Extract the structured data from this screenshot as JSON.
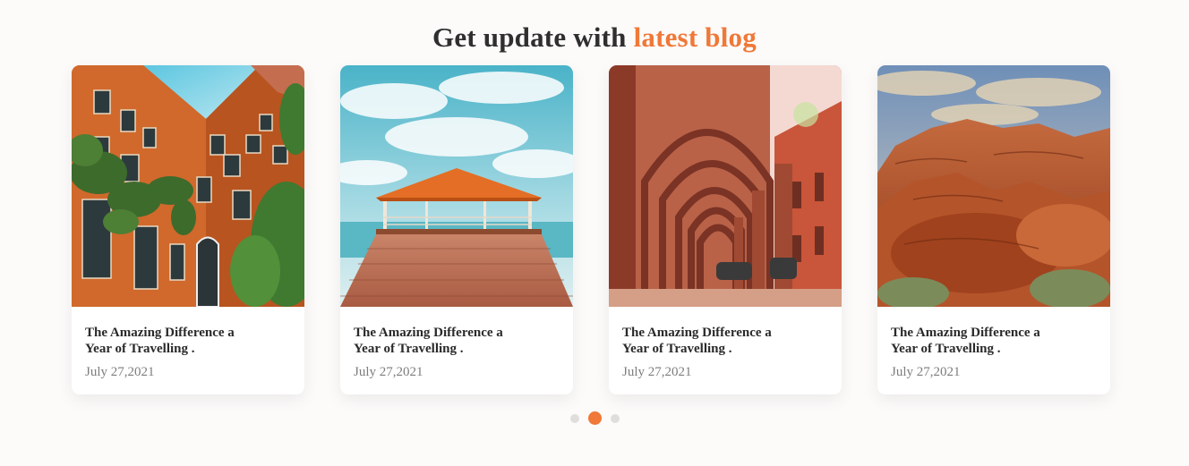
{
  "section": {
    "title_prefix": "Get update with",
    "title_accent": "latest blog",
    "accent_color": "#f07838"
  },
  "cards": [
    {
      "image": "building-courtyard-photo",
      "title": "The Amazing Difference a Year of Travelling .",
      "date": "July 27,2021"
    },
    {
      "image": "beach-pier-gazebo-photo",
      "title": "The Amazing Difference a Year of Travelling .",
      "date": "July 27,2021"
    },
    {
      "image": "arched-colonnade-photo",
      "title": "The Amazing Difference a Year of Travelling .",
      "date": "July 27,2021"
    },
    {
      "image": "red-rock-canyon-photo",
      "title": "The Amazing Difference a Year of Travelling .",
      "date": "July 27,2021"
    }
  ],
  "pagination": {
    "count": 3,
    "active_index": 1
  }
}
